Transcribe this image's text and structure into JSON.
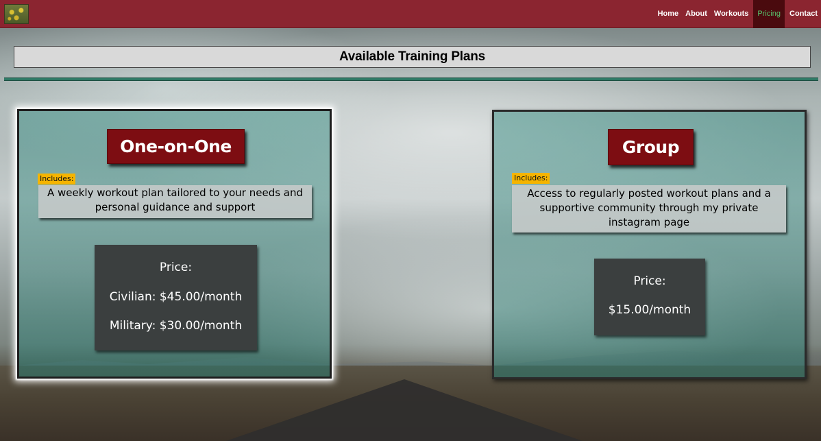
{
  "nav": {
    "links": [
      {
        "label": "Home",
        "active": false
      },
      {
        "label": "About",
        "active": false
      },
      {
        "label": "Workouts",
        "active": false
      },
      {
        "label": "Pricing",
        "active": true
      },
      {
        "label": "Contact",
        "active": false
      }
    ]
  },
  "page": {
    "title": "Available Training Plans"
  },
  "plans": [
    {
      "name": "One-on-One",
      "includes_tag": "Includes:",
      "includes_text": "A weekly workout plan tailored to your needs and personal guidance and support",
      "price_label": "Price:",
      "prices": [
        "Civilian: $45.00/month",
        "Military: $30.00/month"
      ]
    },
    {
      "name": "Group",
      "includes_tag": "Includes:",
      "includes_text": "Access to regularly posted workout plans and a supportive community through my private instagram page",
      "price_label": "Price:",
      "prices": [
        "$15.00/month"
      ]
    }
  ],
  "colors": {
    "navbar": "#8b2530",
    "nav_active_bg": "#4a0a0e",
    "nav_active_text": "#58c46c",
    "plan_name_bg": "#7d0d12",
    "includes_tag_bg": "#f5b400",
    "price_box_bg": "#3b3f3f",
    "title_rule": "#2f7a66"
  }
}
